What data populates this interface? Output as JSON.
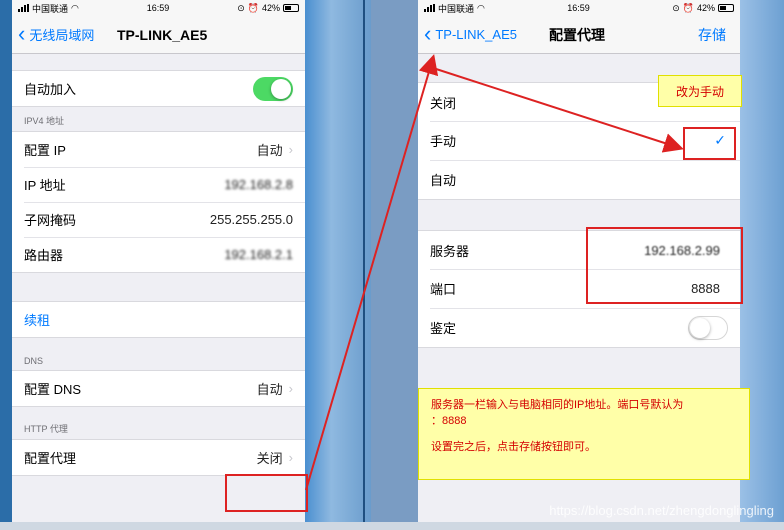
{
  "left": {
    "status": {
      "carrier": "中国联通",
      "time": "16:59",
      "battery": "42%"
    },
    "nav": {
      "back": "无线局域网",
      "title": "TP-LINK_AE5"
    },
    "auto_join": "自动加入",
    "ipv4_header": "IPV4 地址",
    "config_ip": {
      "label": "配置 IP",
      "value": "自动"
    },
    "ip_address": {
      "label": "IP 地址",
      "value": "192.168.2.8"
    },
    "subnet": {
      "label": "子网掩码",
      "value": "255.255.255.0"
    },
    "router": {
      "label": "路由器",
      "value": "192.168.2.1"
    },
    "renew": "续租",
    "dns_header": "DNS",
    "config_dns": {
      "label": "配置 DNS",
      "value": "自动"
    },
    "http_header": "HTTP 代理",
    "config_proxy": {
      "label": "配置代理",
      "value": "关闭"
    }
  },
  "right": {
    "status": {
      "carrier": "中国联通",
      "time": "16:59",
      "battery": "42%"
    },
    "nav": {
      "back": "TP-LINK_AE5",
      "title": "配置代理",
      "save": "存储"
    },
    "options": {
      "off": "关闭",
      "manual": "手动",
      "auto": "自动"
    },
    "server": {
      "label": "服务器",
      "value": "192.168.2.99"
    },
    "port": {
      "label": "端口",
      "value": "8888"
    },
    "auth": "鉴定"
  },
  "annotations": {
    "change_manual": "改为手动",
    "note_line1": "服务器一栏输入与电脑相同的IP地址。端口号默认为",
    "note_line2": "：8888",
    "note_line3": "设置完之后，点击存储按钮即可。"
  },
  "watermark": "https://blog.csdn.net/zhengdonglingling",
  "colors": {
    "ios_blue": "#007aff",
    "toggle_on": "#4cd964",
    "highlight_red": "#dd2222",
    "note_bg": "#ffffa8"
  }
}
